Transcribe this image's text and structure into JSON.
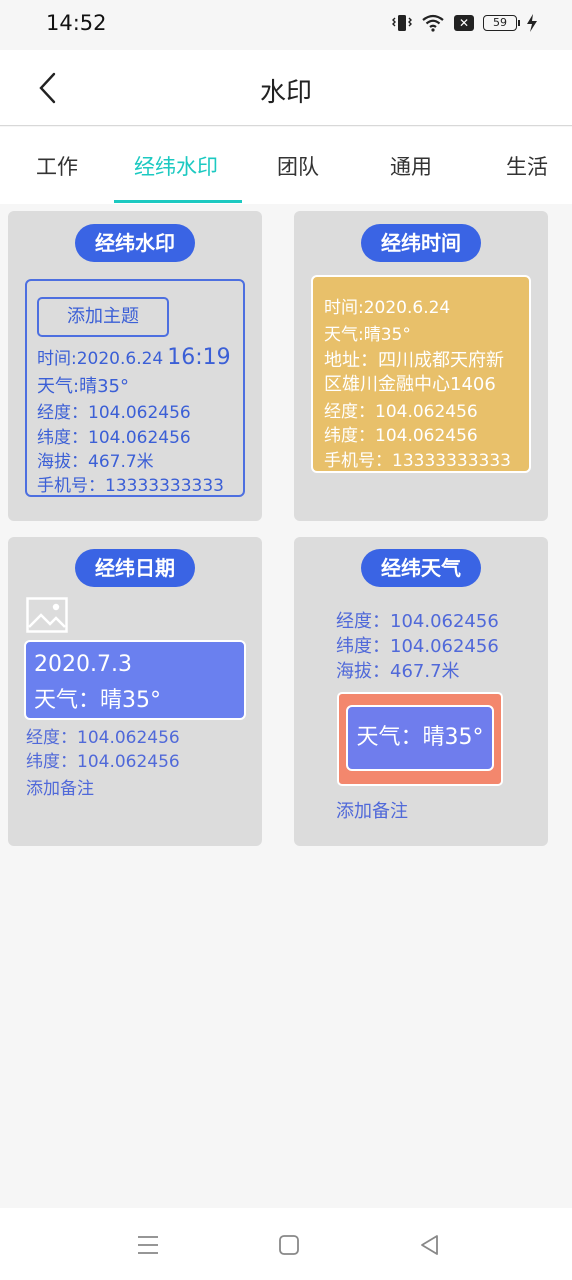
{
  "status_bar": {
    "time": "14:52",
    "icons": [
      "vibrate-icon",
      "wifi-icon",
      "sim-off-icon",
      "battery-icon",
      "charging-icon"
    ],
    "battery": "59"
  },
  "header": {
    "back_icon": "chevron-left-icon",
    "title": "水印"
  },
  "tabs": [
    {
      "label": "工作",
      "active": false
    },
    {
      "label": "经纬水印",
      "active": true
    },
    {
      "label": "团队",
      "active": false
    },
    {
      "label": "通用",
      "active": false
    },
    {
      "label": "生活",
      "active": false
    }
  ],
  "accent_color": "#1cc9c1",
  "cards": [
    {
      "title": "经纬水印",
      "add_theme": "添加主题",
      "time_label": "时间:2020.6.24",
      "time_big": "16:19",
      "weather": "天气:晴35°",
      "longitude": "经度：104.062456",
      "latitude": "纬度：104.062456",
      "altitude": "海拔：467.7米",
      "phone": "手机号：13333333333"
    },
    {
      "title": "经纬时间",
      "time": "时间:2020.6.24",
      "weather": "天气:晴35°",
      "address_line1": "地址：四川成都天府新",
      "address_line2": "区雄川金融中心1406",
      "longitude": "经度：104.062456",
      "latitude": "纬度：104.062456",
      "phone": "手机号：13333333333"
    },
    {
      "title": "经纬日期",
      "image_icon": "image-icon",
      "date": "2020.7.3",
      "weather": "天气：晴35°",
      "longitude": "经度：104.062456",
      "latitude": "纬度：104.062456",
      "add_note": "添加备注"
    },
    {
      "title": "经纬天气",
      "longitude": "经度：104.062456",
      "latitude": "纬度：104.062456",
      "altitude": "海拔：467.7米",
      "weather": "天气：晴35°",
      "add_note": "添加备注"
    }
  ],
  "nav_bar": {
    "icons": [
      "menu-icon",
      "home-square-icon",
      "back-triangle-icon"
    ]
  }
}
